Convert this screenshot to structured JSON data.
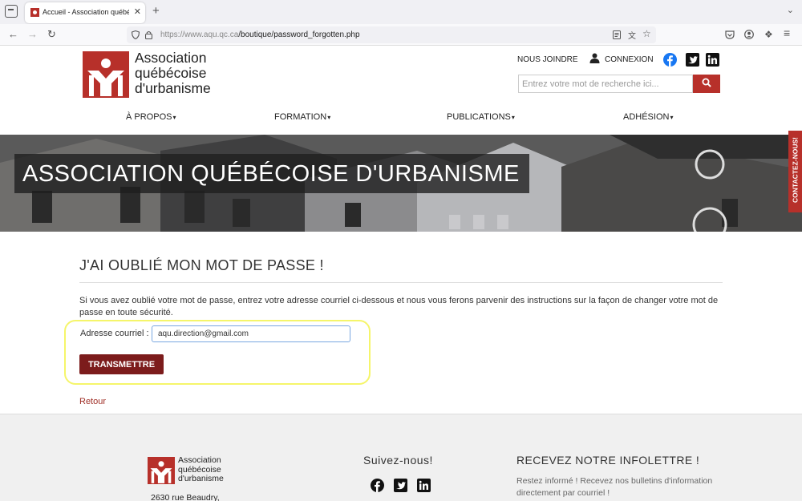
{
  "browser": {
    "tab_title": "Accueil - Association québécoise d'urbanisme",
    "tab_close": "✕",
    "new_tab": "+",
    "url_host": "https://www.aqu.qc.ca",
    "url_path": "/boutique/password_forgotten.php"
  },
  "header": {
    "logo_lines": [
      "Association",
      "québécoise",
      "d'urbanisme"
    ],
    "join_label": "NOUS JOINDRE",
    "login_label": "CONNEXION",
    "search_placeholder": "Entrez votre mot de recherche ici...",
    "social": [
      "facebook-icon",
      "twitter-icon",
      "linkedin-icon"
    ]
  },
  "menu": [
    "À PROPOS",
    "FORMATION",
    "PUBLICATIONS",
    "ADHÉSION"
  ],
  "hero": {
    "title": "ASSOCIATION QUÉBÉCOISE D'URBANISME",
    "contact_tab": "CONTACTEZ-NOUS!"
  },
  "main": {
    "title": "J'AI OUBLIÉ MON MOT DE PASSE !",
    "intro": "Si vous avez oublié votre mot de passe, entrez votre adresse courriel ci-dessous et nous vous ferons parvenir des instructions sur la façon de changer votre mot de passe en toute sécurité.",
    "email_label": "Adresse courriel :",
    "email_value": "aqu.direction@gmail.com",
    "submit_label": "TRANSMETTRE",
    "back_label": "Retour"
  },
  "footer": {
    "logo_lines": [
      "Association",
      "québécoise",
      "d'urbanisme"
    ],
    "address": "2630 rue Beaudry,",
    "follow_title": "Suivez-nous!",
    "newsletter_title": "RECEVEZ NOTRE INFOLETTRE !",
    "newsletter_text": "Restez informé ! Recevez nos bulletins d'information directement par courriel !"
  },
  "colors": {
    "brand_red": "#b7302a",
    "button_dark_red": "#7c1c1c",
    "highlight_yellow": "#f5f56a"
  }
}
